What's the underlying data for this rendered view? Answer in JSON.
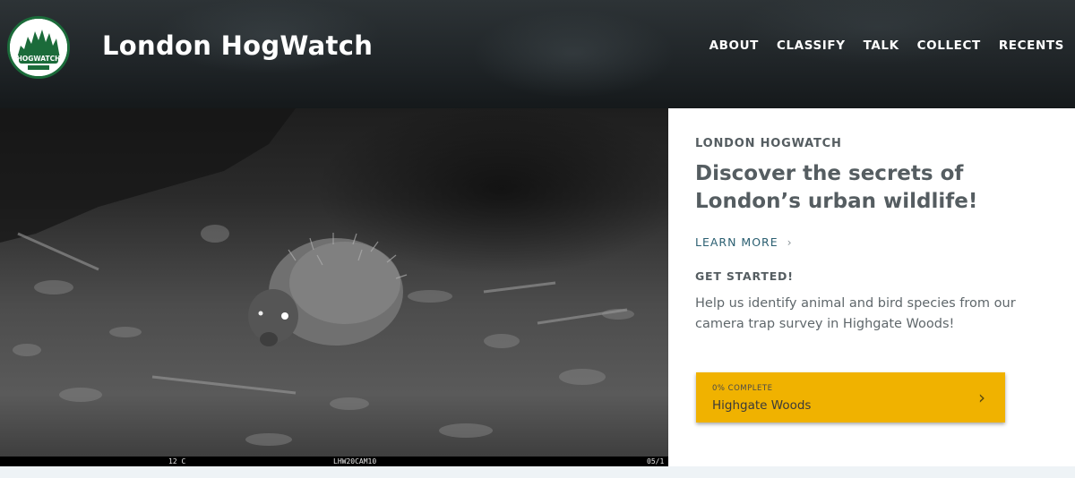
{
  "header": {
    "logo_icon": "hogwatch-logo",
    "logo_text": "HOGWATCH",
    "title": "London HogWatch",
    "nav": [
      "ABOUT",
      "CLASSIFY",
      "TALK",
      "COLLECT",
      "RECENTS"
    ]
  },
  "photo": {
    "subject": "hedgehog",
    "strip": {
      "temperature": "12 C",
      "camera": "LHW20CAM10",
      "date": "05/1"
    }
  },
  "panel": {
    "eyebrow": "LONDON HOGWATCH",
    "headline": "Discover the secrets of London’s urban wildlife!",
    "learn_more": "LEARN MORE",
    "learn_more_icon": "chevron-right-icon",
    "get_started": "GET STARTED!",
    "help_text": "Help us identify animal and bird species from our camera trap survey in Highgate Woods!",
    "project": {
      "progress_label": "0% COMPLETE",
      "progress": 0,
      "name": "Highgate Woods",
      "icon": "chevron-right-icon"
    }
  },
  "colors": {
    "accent": "#f0b200",
    "link": "#2b5f71",
    "text": "#555d61",
    "logo_green": "#1b6b3a"
  }
}
